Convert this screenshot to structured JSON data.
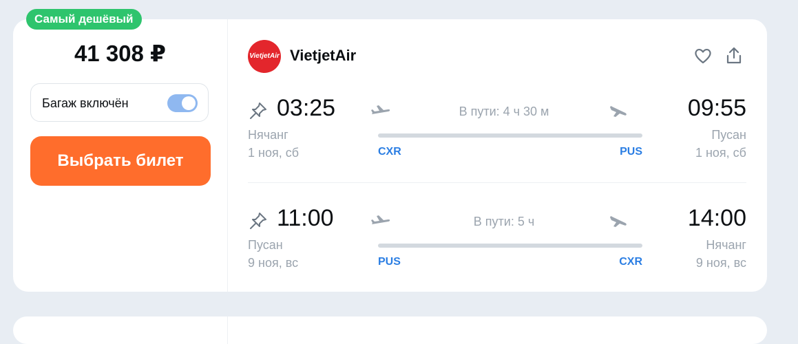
{
  "badge": "Самый дешёвый",
  "price": "41 308 ₽",
  "baggage": {
    "label": "Багаж включён",
    "enabled": true
  },
  "buy_button": "Выбрать билет",
  "airline": {
    "name": "VietjetAir",
    "logo_text": "VietjetAir"
  },
  "segments": [
    {
      "departure_time": "03:25",
      "departure_city": "Нячанг",
      "departure_date": "1 ноя, сб",
      "departure_code": "CXR",
      "duration": "В пути: 4 ч 30 м",
      "arrival_time": "09:55",
      "arrival_city": "Пусан",
      "arrival_date": "1 ноя, сб",
      "arrival_code": "PUS"
    },
    {
      "departure_time": "11:00",
      "departure_city": "Пусан",
      "departure_date": "9 ноя, вс",
      "departure_code": "PUS",
      "duration": "В пути: 5 ч",
      "arrival_time": "14:00",
      "arrival_city": "Нячанг",
      "arrival_date": "9 ноя, вс",
      "arrival_code": "CXR"
    }
  ],
  "colors": {
    "badge": "#2ec46d",
    "buy_button": "#ff6d2c",
    "toggle": "#8fb8f0",
    "iata": "#2b7ee3",
    "airline_logo": "#e3262c"
  }
}
